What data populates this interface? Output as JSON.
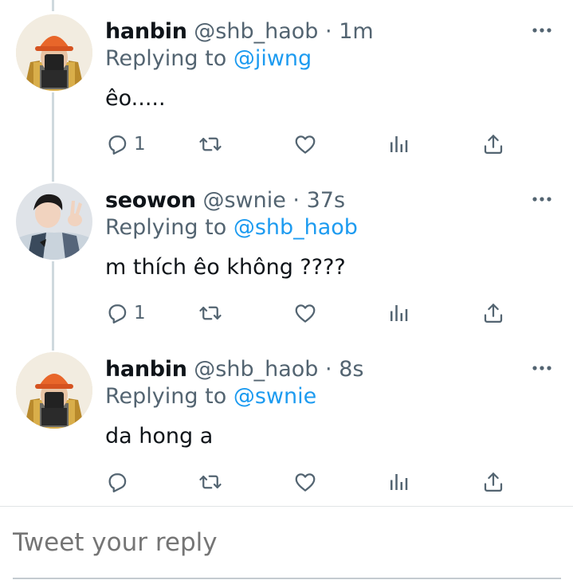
{
  "tweets": [
    {
      "name": "hanbin",
      "handle": "@shb_haob",
      "dot": "·",
      "time": "1m",
      "replying_prefix": "Replying to ",
      "replying_to": "@jiwng",
      "text": "êo.....",
      "reply_count": "1",
      "avatar": "hat-selfie"
    },
    {
      "name": "seowon",
      "handle": "@swnie",
      "dot": "·",
      "time": "37s",
      "replying_prefix": "Replying to ",
      "replying_to": "@shb_haob",
      "text": "m thích êo không ????",
      "reply_count": "1",
      "avatar": "peace-sign"
    },
    {
      "name": "hanbin",
      "handle": "@shb_haob",
      "dot": "·",
      "time": "8s",
      "replying_prefix": "Replying to ",
      "replying_to": "@swnie",
      "text": "da hong a",
      "reply_count": "",
      "avatar": "hat-selfie"
    }
  ],
  "composer": {
    "placeholder": "Tweet your reply"
  },
  "colors": {
    "accent": "#1d9bf0",
    "secondary_text": "#536471",
    "thread_line": "#cfd9de"
  },
  "icons": [
    "more-icon",
    "reply-icon",
    "retweet-icon",
    "like-icon",
    "analytics-icon",
    "share-icon"
  ]
}
